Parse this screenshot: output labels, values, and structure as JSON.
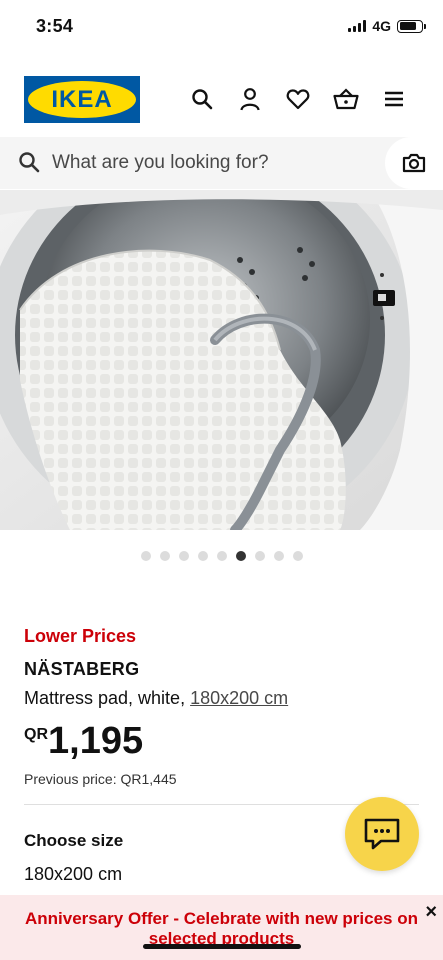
{
  "status": {
    "time": "3:54",
    "network": "4G"
  },
  "brand": {
    "logo_text": "IKEA",
    "blue": "#0058a3",
    "yellow": "#ffdb00"
  },
  "header": {
    "icons": [
      "search-icon",
      "account-icon",
      "heart-icon",
      "basket-icon",
      "menu-icon"
    ]
  },
  "search": {
    "placeholder": "What are you looking for?",
    "camera_icon": "camera-icon"
  },
  "gallery": {
    "image_count": 9,
    "active_index": 5
  },
  "product": {
    "tag": "Lower Prices",
    "tag_color": "#cc0008",
    "name": "NÄSTABERG",
    "description": "Mattress pad, white, ",
    "size_link": "180x200 cm",
    "currency": "QR",
    "price": "1,195",
    "previous_price": "Previous price: QR1,445"
  },
  "size_selector": {
    "label": "Choose size",
    "value": "180x200 cm"
  },
  "chat": {
    "icon": "chat-icon",
    "color": "#f7d44a"
  },
  "banner": {
    "line1": "Anniversary Offer - Celebrate with new prices on",
    "line2": "selected products",
    "close": "×"
  }
}
